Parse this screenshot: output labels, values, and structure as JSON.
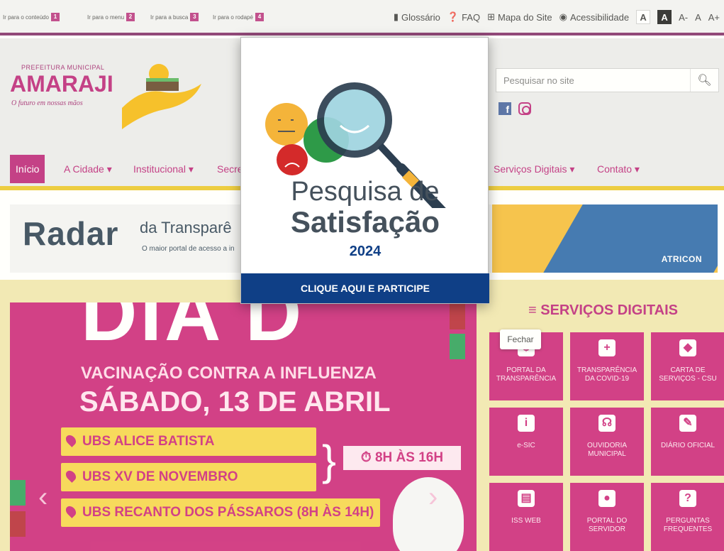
{
  "topbar": {
    "skip_links": [
      {
        "label": "Ir para o conteúdo",
        "key": "1"
      },
      {
        "label": "Ir para o menu",
        "key": "2"
      },
      {
        "label": "Ir para a busca",
        "key": "3"
      },
      {
        "label": "Ir para o rodapé",
        "key": "4"
      }
    ],
    "links": {
      "glossary": "Glossário",
      "faq": "FAQ",
      "sitemap": "Mapa do Site",
      "accessibility": "Acessibilidade"
    },
    "contrast": [
      "A",
      "A"
    ],
    "font_sizes": [
      "A-",
      "A",
      "A+"
    ]
  },
  "header": {
    "logo_top": "PREFEITURA MUNICIPAL",
    "logo_name": "AMARAJI",
    "logo_slogan": "O futuro em nossas mãos",
    "search_placeholder": "Pesquisar no site"
  },
  "nav": {
    "items": [
      "Início",
      "A Cidade ▾",
      "Institucional ▾",
      "Secre",
      "Serviços Digitais ▾",
      "Contato ▾"
    ]
  },
  "banner": {
    "radar": "Radar",
    "da": "da Transparê",
    "sub": "O maior portal de acesso a in",
    "partner": "ATRICON"
  },
  "slide": {
    "big": "DIA D",
    "line1": "VACINAÇÃO CONTRA A INFLUENZA",
    "line2": "SÁBADO, 13 DE ABRIL",
    "ubs": [
      "UBS ALICE BATISTA",
      "UBS XV DE NOVEMBRO",
      "UBS RECANTO DOS PÁSSAROS (8H ÀS 14H)"
    ],
    "hours": "⏱ 8H ÀS 16H"
  },
  "services": {
    "title": "≡ SERVIÇOS DIGITAIS",
    "tiles": [
      {
        "icon": "$",
        "label": "PORTAL DA TRANSPARÊNCIA"
      },
      {
        "icon": "+",
        "label": "TRANSPARÊNCIA DA COVID-19"
      },
      {
        "icon": "◆",
        "label": "CARTA DE SERVIÇOS - CSU"
      },
      {
        "icon": "i",
        "label": "e-SIC"
      },
      {
        "icon": "☊",
        "label": "OUVIDORIA MUNICIPAL"
      },
      {
        "icon": "✎",
        "label": "DIÁRIO OFICIAL"
      },
      {
        "icon": "▤",
        "label": "ISS WEB"
      },
      {
        "icon": "●",
        "label": "PORTAL DO SERVIDOR"
      },
      {
        "icon": "?",
        "label": "PERGUNTAS FREQUENTES"
      }
    ],
    "tooltip": "Fechar"
  },
  "modal": {
    "title1": "Pesquisa de",
    "title2": "Satisfação",
    "year": "2024",
    "cta": "CLIQUE AQUI E PARTICIPE"
  },
  "colors": {
    "brand": "#b8186f",
    "accent": "#e9c21c",
    "cta": "#0f3f86"
  }
}
